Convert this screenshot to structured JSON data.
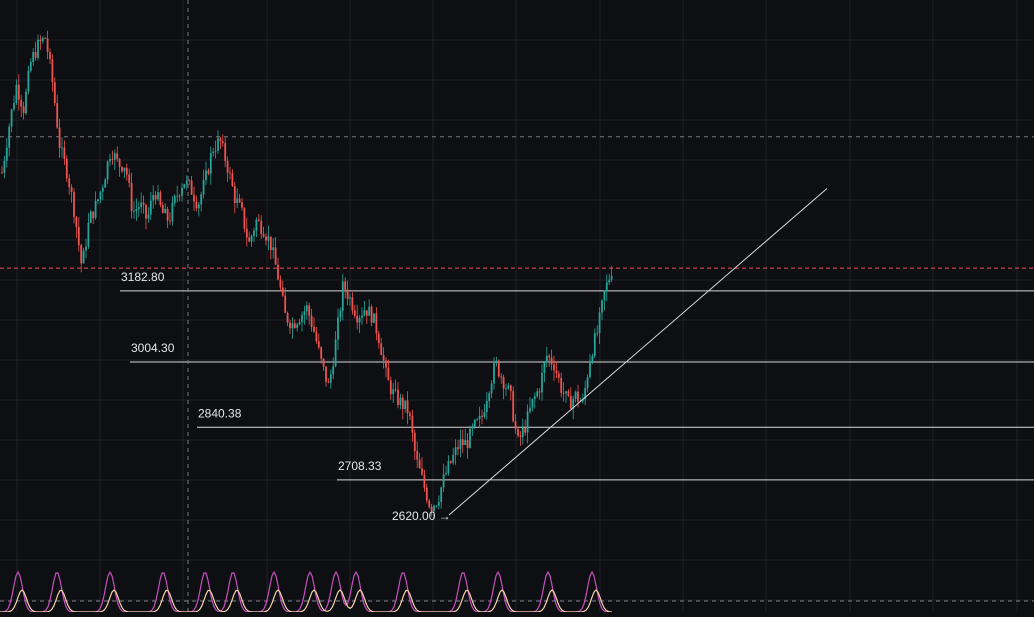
{
  "chart_data": {
    "type": "candlestick",
    "title": "",
    "xlabel": "",
    "ylabel": "",
    "price_scale": {
      "top_price": 3700,
      "bottom_price": 2620
    },
    "colors": {
      "background": "#0e0f12",
      "grid": "#1e2128",
      "crosshair": "#7a7d86",
      "up": "#26a69a",
      "down": "#ef5350",
      "price_line": "#ef5350",
      "level_line": "#d8d8d8",
      "trendline": "#d8d8d8",
      "osc_fast": "#c850c0",
      "osc_slow": "#f4d1a6"
    },
    "current_price": 3240,
    "crosshair_price": 3570,
    "levels": [
      {
        "label": "3182.80",
        "value": 3182.8
      },
      {
        "label": "3004.30",
        "value": 3004.3
      },
      {
        "label": "2840.38",
        "value": 2840.38
      },
      {
        "label": "2708.33",
        "value": 2708.33
      }
    ],
    "low_marker": {
      "label": "2620.00 →",
      "value": 2620.0
    },
    "trendline": {
      "from_price": 2620,
      "to_price": 3440
    },
    "price_path": [
      3480,
      3600,
      3700,
      3640,
      3760,
      3800,
      3820,
      3700,
      3540,
      3480,
      3380,
      3240,
      3360,
      3400,
      3460,
      3540,
      3500,
      3500,
      3380,
      3400,
      3360,
      3440,
      3380,
      3360,
      3420,
      3460,
      3440,
      3400,
      3460,
      3540,
      3560,
      3500,
      3420,
      3380,
      3300,
      3360,
      3340,
      3300,
      3220,
      3120,
      3100,
      3120,
      3140,
      3080,
      3000,
      2940,
      3060,
      3200,
      3160,
      3120,
      3140,
      3120,
      3060,
      2960,
      2920,
      2900,
      2880,
      2760,
      2700,
      2640,
      2660,
      2720,
      2760,
      2800,
      2800,
      2840,
      2860,
      2940,
      3000,
      2960,
      2920,
      2800,
      2840,
      2900,
      2940,
      3020,
      3000,
      2940,
      2900,
      2920,
      2900,
      3020,
      3080,
      3180,
      3240
    ]
  }
}
